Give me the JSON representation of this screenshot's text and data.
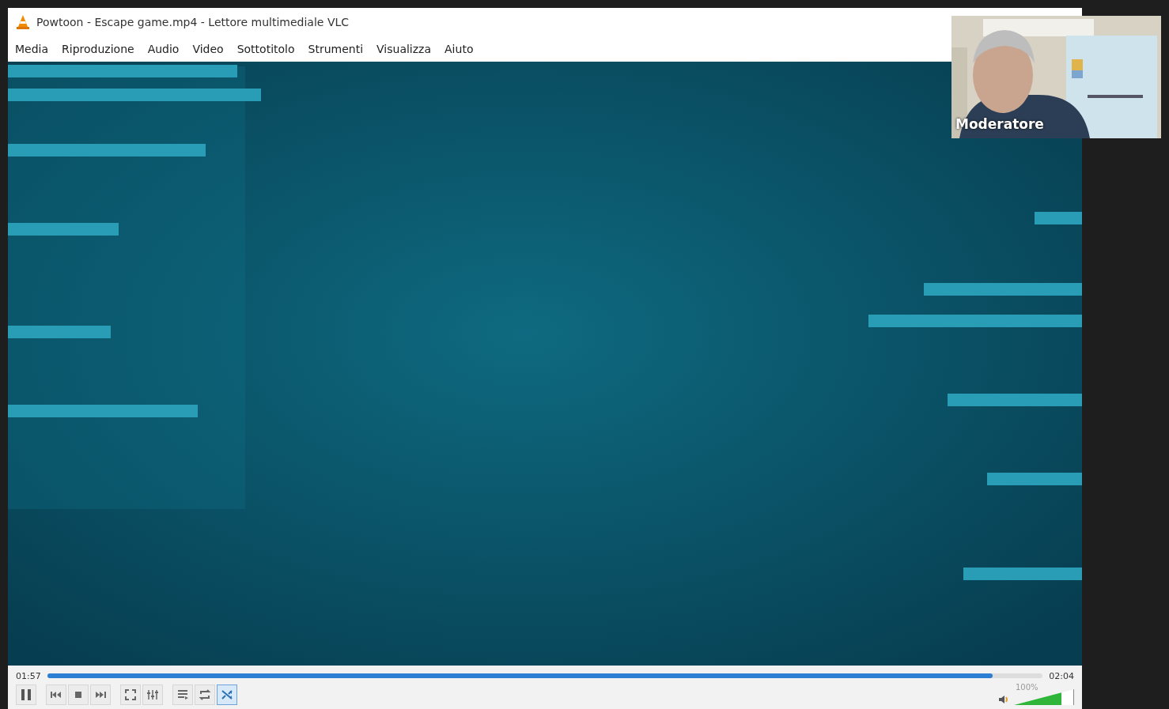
{
  "window": {
    "title": "Powtoon - Escape game.mp4 - Lettore multimediale VLC"
  },
  "menu": [
    "Media",
    "Riproduzione",
    "Audio",
    "Video",
    "Sottotitolo",
    "Strumenti",
    "Visualizza",
    "Aiuto"
  ],
  "video": {
    "kind": "picture"
  },
  "player": {
    "elapsed": "01:57",
    "total": "02:04",
    "seek": {
      "level": 0.95
    },
    "buttons": [
      {
        "kind": "pause",
        "on": false
      },
      {
        "kind": "previous",
        "on": false
      },
      {
        "kind": "stop",
        "on": false
      },
      {
        "kind": "next",
        "on": false
      },
      {
        "kind": "fullscreen",
        "on": false
      },
      {
        "kind": "equalizer",
        "on": false
      },
      {
        "kind": "playlist",
        "on": false
      },
      {
        "kind": "loop",
        "on": false
      },
      {
        "kind": "shuffle",
        "on": true
      }
    ],
    "volume": {
      "reading": "100%",
      "level": 0.8
    }
  },
  "webcam": {
    "label": "Moderatore"
  }
}
